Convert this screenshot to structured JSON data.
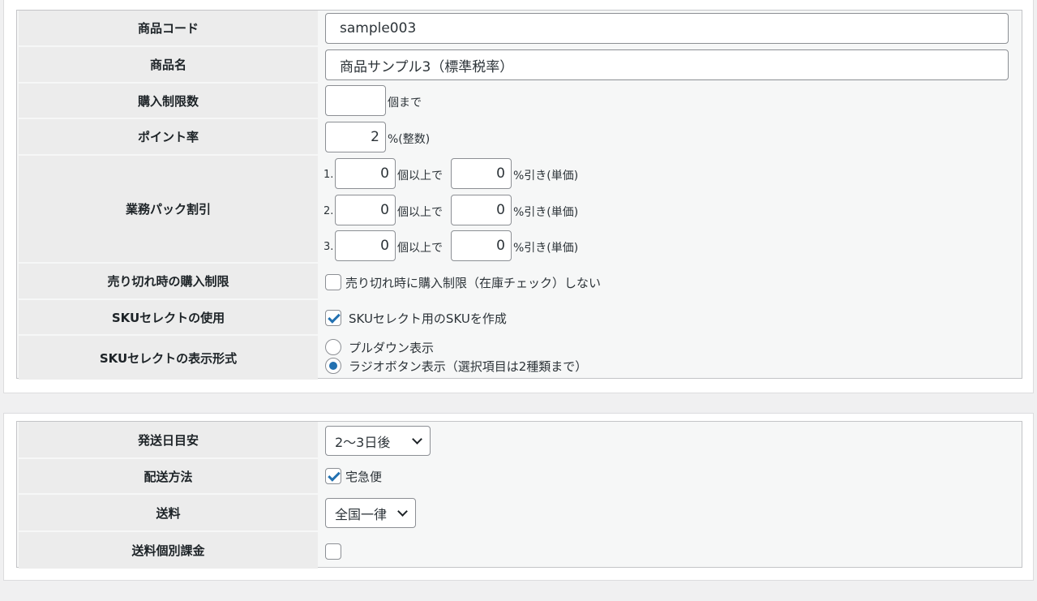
{
  "product": {
    "code": {
      "label": "商品コード",
      "value": "sample003"
    },
    "name": {
      "label": "商品名",
      "value": "商品サンプル3（標準税率）"
    },
    "purchase_limit": {
      "label": "購入制限数",
      "value": "",
      "suffix": "個まで"
    },
    "point_rate": {
      "label": "ポイント率",
      "value": "2",
      "suffix": "%(整数)"
    },
    "business_pack": {
      "label": "業務パック割引",
      "tiers": [
        {
          "index": "1.",
          "qty": "0",
          "qty_suffix": "個以上で",
          "discount": "0",
          "discount_suffix": "%引き(単価)"
        },
        {
          "index": "2.",
          "qty": "0",
          "qty_suffix": "個以上で",
          "discount": "0",
          "discount_suffix": "%引き(単価)"
        },
        {
          "index": "3.",
          "qty": "0",
          "qty_suffix": "個以上で",
          "discount": "0",
          "discount_suffix": "%引き(単価)"
        }
      ]
    },
    "soldout_limit": {
      "label": "売り切れ時の購入制限",
      "checkbox_label": "売り切れ時に購入制限（在庫チェック）しない",
      "checked": false
    },
    "sku_select": {
      "label": "SKUセレクトの使用",
      "checkbox_label": "SKUセレクト用のSKUを作成",
      "checked": true
    },
    "sku_display": {
      "label": "SKUセレクトの表示形式",
      "options": [
        {
          "label": "プルダウン表示",
          "checked": false
        },
        {
          "label": "ラジオボタン表示（選択項目は2種類まで）",
          "checked": true
        }
      ]
    }
  },
  "shipping": {
    "ship_date": {
      "label": "発送日目安",
      "selected": "2〜3日後"
    },
    "method": {
      "label": "配送方法",
      "checkbox_label": "宅急便",
      "checked": true
    },
    "fee": {
      "label": "送料",
      "selected": "全国一律"
    },
    "individual_fee": {
      "label": "送料個別課金",
      "checked": false
    }
  },
  "colors": {
    "accent": "#2271b1",
    "header_bg": "#ececec",
    "border": "#8c8f94"
  }
}
